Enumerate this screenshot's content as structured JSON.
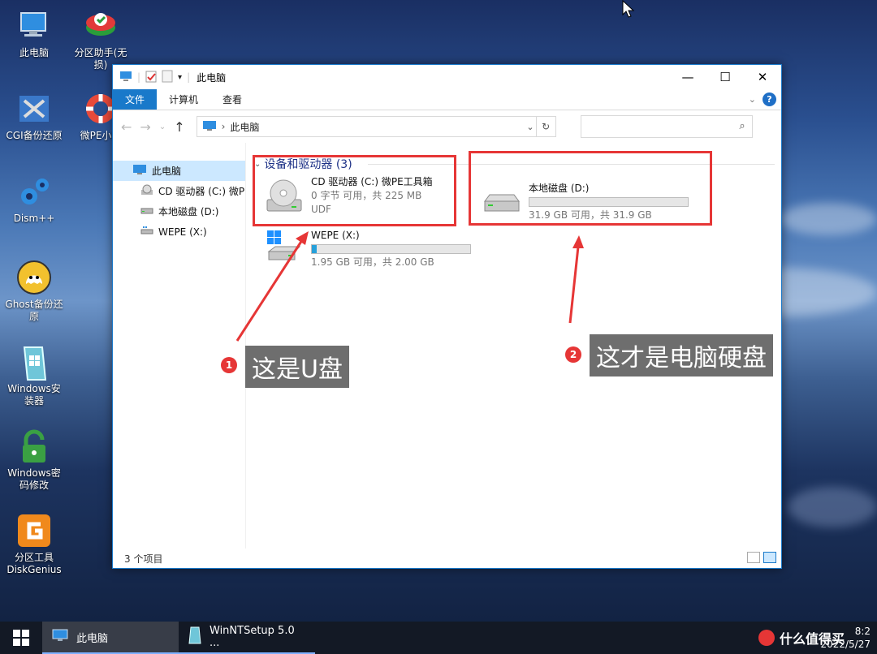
{
  "desktop": {
    "icons": [
      {
        "label": "此电脑",
        "icon": "computer-icon"
      },
      {
        "label": "分区助手(无损)",
        "icon": "partition-assistant-icon"
      },
      {
        "label": "CGI备份还原",
        "icon": "cgi-backup-icon"
      },
      {
        "label": "微PE小时",
        "icon": "lifebuoy-icon"
      },
      {
        "label": "Dism++",
        "icon": "gears-icon"
      },
      {
        "label": "Ghost备份还原",
        "icon": "ghost-icon"
      },
      {
        "label": "Windows安装器",
        "icon": "windows-installer-icon"
      },
      {
        "label": "Windows密码修改",
        "icon": "lock-icon"
      },
      {
        "label": "分区工具DiskGenius",
        "icon": "diskgenius-icon"
      }
    ]
  },
  "window": {
    "title": "此电脑",
    "ribbon_tabs": [
      "文件",
      "计算机",
      "查看"
    ],
    "address_path": "此电脑",
    "search_placeholder": "",
    "nav": [
      {
        "label": "此电脑",
        "icon": "computer-icon"
      },
      {
        "label": "CD 驱动器 (C:) 微P",
        "icon": "cd-drive-icon"
      },
      {
        "label": "本地磁盘 (D:)",
        "icon": "hard-drive-icon"
      },
      {
        "label": "WEPE (X:)",
        "icon": "usb-drive-icon"
      }
    ],
    "group_header": "设备和驱动器 (3)",
    "drives": [
      {
        "name": "CD 驱动器 (C:) 微PE工具箱",
        "line2": "0 字节 可用，共 225 MB",
        "line3": "UDF",
        "icon": "cd-drive-icon"
      },
      {
        "name": "WEPE (X:)",
        "usage": 0.03,
        "free_text": "1.95 GB 可用，共 2.00 GB",
        "icon": "windows-drive-icon"
      },
      {
        "name": "本地磁盘 (D:)",
        "usage": 0.0,
        "free_text": "31.9 GB 可用，共 31.9 GB",
        "icon": "hard-drive-icon"
      }
    ],
    "status": "3 个项目"
  },
  "annotations": [
    {
      "num": "1",
      "text": "这是U盘"
    },
    {
      "num": "2",
      "text": "这才是电脑硬盘"
    }
  ],
  "taskbar": {
    "items": [
      {
        "label": "此电脑",
        "icon": "computer-icon"
      },
      {
        "label": "WinNTSetup 5.0 ...",
        "icon": "winntsetup-icon"
      }
    ],
    "clock_time": "8:2",
    "clock_date": "2022/5/27",
    "watermark": "什么值得买"
  },
  "colors": {
    "accent": "#1979ca",
    "annotation_red": "#e63636",
    "group_header": "#1e3287"
  }
}
